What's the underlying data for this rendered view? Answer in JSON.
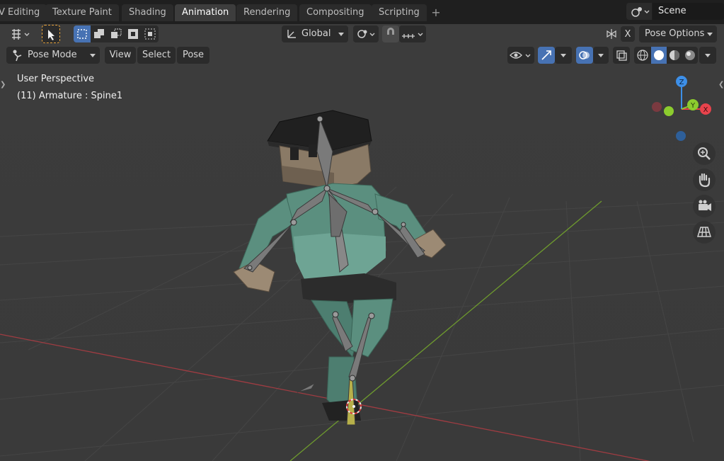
{
  "workspace_tabs": [
    {
      "label": "V Editing",
      "active": false
    },
    {
      "label": "Texture Paint",
      "active": false
    },
    {
      "label": "Shading",
      "active": false
    },
    {
      "label": "Animation",
      "active": true
    },
    {
      "label": "Rendering",
      "active": false
    },
    {
      "label": "Compositing",
      "active": false
    },
    {
      "label": "Scripting",
      "active": false
    }
  ],
  "add_tab_symbol": "+",
  "scene": {
    "value": "Scene"
  },
  "toolbar": {
    "transform_orientation": "Global",
    "x_mirror_label": "X",
    "pose_options_label": "Pose Options"
  },
  "header": {
    "mode_label": "Pose Mode",
    "menu": [
      "View",
      "Select",
      "Pose"
    ]
  },
  "overlay": {
    "perspective_label": "User Perspective",
    "object_info": "(11) Armature : Spine1"
  },
  "gizmo": {
    "z_label": "Z",
    "y_label": "Y",
    "x_label": "X",
    "colors": {
      "x": "#e8434c",
      "y": "#8ccc2e",
      "z": "#3d8fe8"
    }
  },
  "icons": {
    "editor_type": "editor-type-icon",
    "select_tool": "cursor-select-icon",
    "viewport_nav": [
      "zoom-icon",
      "hand-pan-icon",
      "camera-icon",
      "grid-ortho-icon"
    ]
  },
  "colors": {
    "accent": "#4772b3",
    "background": "#3d3d3d",
    "header_bg": "#1f1f1f"
  }
}
